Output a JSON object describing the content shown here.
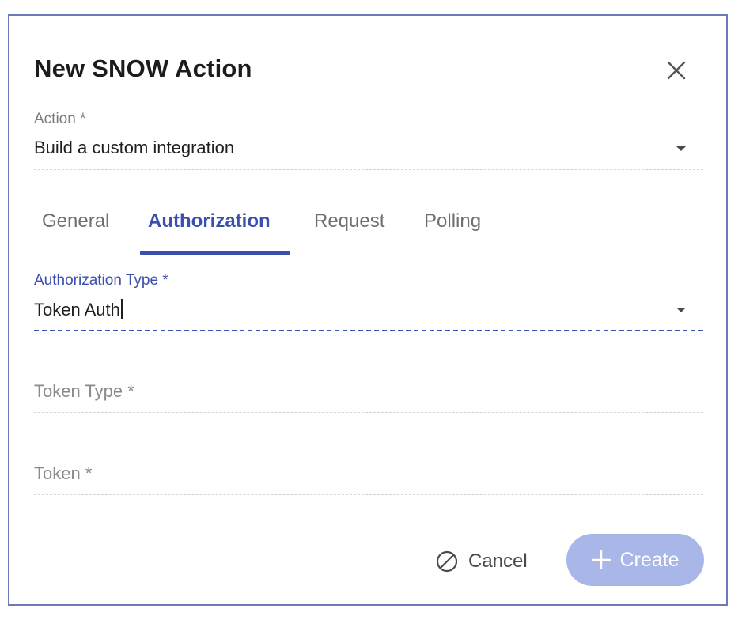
{
  "dialog": {
    "title": "New SNOW Action",
    "close_icon": "close-icon"
  },
  "action_field": {
    "label": "Action *",
    "value": "Build a custom integration",
    "dropdown_icon": "caret-down-icon"
  },
  "tabs": [
    {
      "label": "General",
      "active": false
    },
    {
      "label": "Authorization",
      "active": true
    },
    {
      "label": "Request",
      "active": false
    },
    {
      "label": "Polling",
      "active": false
    }
  ],
  "authorization_type": {
    "label": "Authorization Type *",
    "value": "Token Auth",
    "dropdown_icon": "caret-down-icon"
  },
  "token_type": {
    "placeholder": "Token Type *"
  },
  "token": {
    "placeholder": "Token *"
  },
  "footer": {
    "cancel_label": "Cancel",
    "cancel_icon": "cancel-circle-slash-icon",
    "create_label": "Create",
    "create_icon": "plus-icon"
  },
  "colors": {
    "accent": "#3a4fae",
    "create_button_disabled": "#a8b6e8",
    "dialog_border": "#6b7ab8"
  }
}
